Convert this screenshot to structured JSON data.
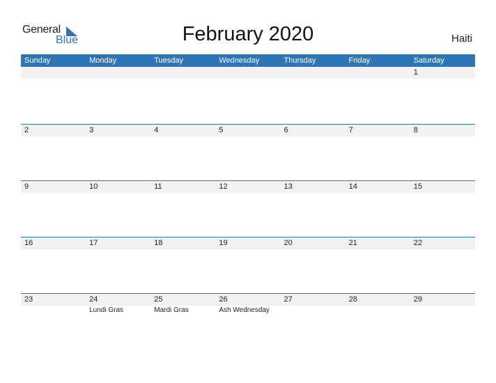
{
  "logo": {
    "text_general": "General",
    "text_blue": "Blue",
    "icon": "triangle-flag-icon"
  },
  "title": "February 2020",
  "country": "Haiti",
  "colors": {
    "accent": "#2e75b6",
    "strip": "#f1f1f1"
  },
  "weekdays": [
    "Sunday",
    "Monday",
    "Tuesday",
    "Wednesday",
    "Thursday",
    "Friday",
    "Saturday"
  ],
  "weeks": [
    [
      {
        "day": "",
        "event": ""
      },
      {
        "day": "",
        "event": ""
      },
      {
        "day": "",
        "event": ""
      },
      {
        "day": "",
        "event": ""
      },
      {
        "day": "",
        "event": ""
      },
      {
        "day": "",
        "event": ""
      },
      {
        "day": "1",
        "event": ""
      }
    ],
    [
      {
        "day": "2",
        "event": ""
      },
      {
        "day": "3",
        "event": ""
      },
      {
        "day": "4",
        "event": ""
      },
      {
        "day": "5",
        "event": ""
      },
      {
        "day": "6",
        "event": ""
      },
      {
        "day": "7",
        "event": ""
      },
      {
        "day": "8",
        "event": ""
      }
    ],
    [
      {
        "day": "9",
        "event": ""
      },
      {
        "day": "10",
        "event": ""
      },
      {
        "day": "11",
        "event": ""
      },
      {
        "day": "12",
        "event": ""
      },
      {
        "day": "13",
        "event": ""
      },
      {
        "day": "14",
        "event": ""
      },
      {
        "day": "15",
        "event": ""
      }
    ],
    [
      {
        "day": "16",
        "event": ""
      },
      {
        "day": "17",
        "event": ""
      },
      {
        "day": "18",
        "event": ""
      },
      {
        "day": "19",
        "event": ""
      },
      {
        "day": "20",
        "event": ""
      },
      {
        "day": "21",
        "event": ""
      },
      {
        "day": "22",
        "event": ""
      }
    ],
    [
      {
        "day": "23",
        "event": ""
      },
      {
        "day": "24",
        "event": "Lundi Gras"
      },
      {
        "day": "25",
        "event": "Mardi Gras"
      },
      {
        "day": "26",
        "event": "Ash Wednesday"
      },
      {
        "day": "27",
        "event": ""
      },
      {
        "day": "28",
        "event": ""
      },
      {
        "day": "29",
        "event": ""
      }
    ]
  ]
}
